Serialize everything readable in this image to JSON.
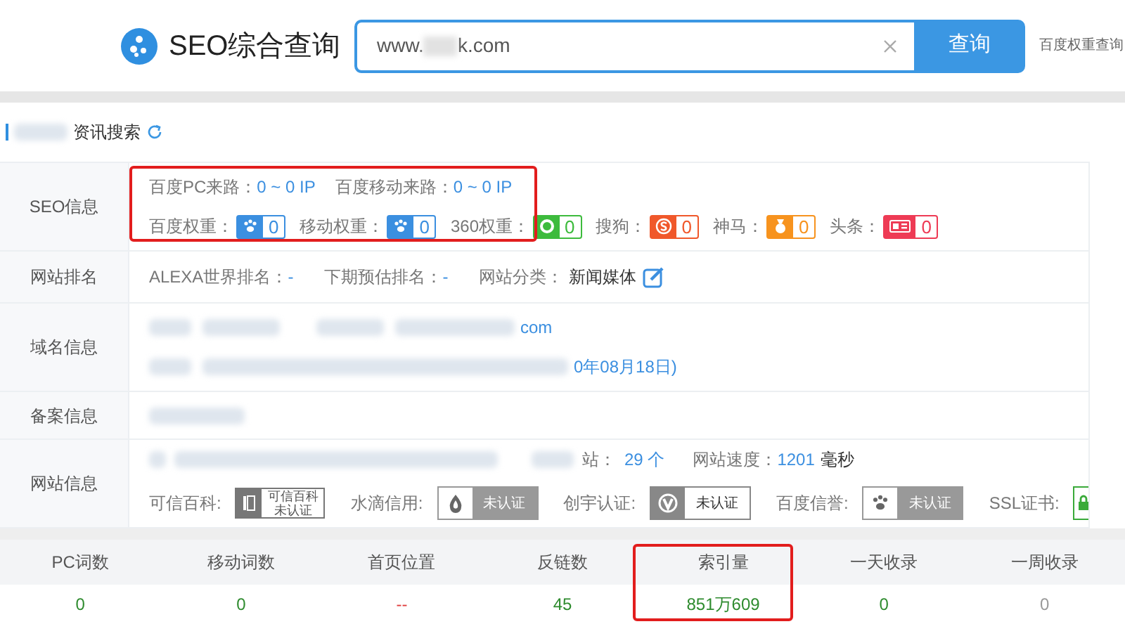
{
  "header": {
    "logo_text": "SEO综合查询",
    "search": {
      "value_prefix": "www.",
      "value_suffix": "k.com"
    },
    "search_button": "查询",
    "side_link": "百度权重查询"
  },
  "section_title": "资讯搜索",
  "seo_info": {
    "label": "SEO信息",
    "highlight": true,
    "traffic": [
      {
        "label": "百度PC来路：",
        "value": "0 ~ 0 IP"
      },
      {
        "label": "百度移动来路：",
        "value": "0 ~ 0 IP"
      }
    ],
    "weights": [
      {
        "label": "百度权重：",
        "kind": "paw",
        "color": "#3b8fe0",
        "value": "0"
      },
      {
        "label": "移动权重：",
        "kind": "paw",
        "color": "#3b8fe0",
        "value": "0"
      },
      {
        "label": "360权重：",
        "kind": "ring",
        "color": "#3dbb3d",
        "value": "0"
      },
      {
        "label": "搜狗：",
        "kind": "sogou",
        "color": "#f0582b",
        "value": "0"
      },
      {
        "label": "神马：",
        "kind": "shenma",
        "color": "#f7931e",
        "value": "0"
      },
      {
        "label": "头条：",
        "kind": "toutiao",
        "color": "#ee3b55",
        "value": "0"
      }
    ]
  },
  "ranking": {
    "label": "网站排名",
    "items": [
      {
        "label": "ALEXA世界排名：",
        "value": "-"
      },
      {
        "label": "下期预估排名：",
        "value": "-"
      }
    ],
    "category_label": "网站分类：",
    "category": "新闻媒体"
  },
  "domain": {
    "label": "域名信息",
    "line_1_tail": "com",
    "line_2_tail": "0年08月18日)"
  },
  "icp": {
    "label": "备案信息"
  },
  "site_info": {
    "label": "网站信息",
    "sites_tail": "站：",
    "sites_value": "29 个",
    "speed_label": "网站速度：",
    "speed_value": "1201",
    "speed_unit": "毫秒",
    "certs": [
      {
        "label": "可信百科:",
        "kind": "kexin",
        "title": "可信百科",
        "status": "未认证"
      },
      {
        "label": "水滴信用:",
        "kind": "drop",
        "status": "未认证"
      },
      {
        "label": "创宇认证:",
        "kind": "v",
        "status": "未认证"
      },
      {
        "label": "百度信誉:",
        "kind": "paw",
        "status": "未认证"
      },
      {
        "label": "SSL证书:",
        "kind": "ssl"
      }
    ]
  },
  "stats": [
    {
      "label": "PC词数",
      "value": "0",
      "color": "#2e8b2e",
      "highlight": false
    },
    {
      "label": "移动词数",
      "value": "0",
      "color": "#2e8b2e",
      "highlight": false
    },
    {
      "label": "首页位置",
      "value": "--",
      "color": "#e04040",
      "highlight": false
    },
    {
      "label": "反链数",
      "value": "45",
      "color": "#2e8b2e",
      "highlight": false
    },
    {
      "label": "索引量",
      "value": "851万609",
      "color": "#2e8b2e",
      "highlight": true
    },
    {
      "label": "一天收录",
      "value": "0",
      "color": "#2e8b2e",
      "highlight": false
    },
    {
      "label": "一周收录",
      "value": "0",
      "color": "#999999",
      "highlight": false
    }
  ]
}
